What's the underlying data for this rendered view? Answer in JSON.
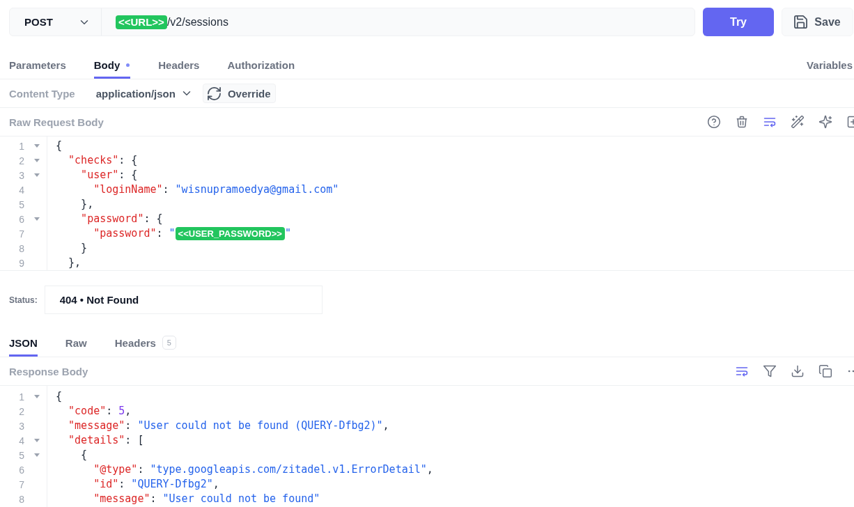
{
  "request": {
    "method": "POST",
    "url_variable": "<<URL>>",
    "url_path": "/v2/sessions",
    "try_button": "Try",
    "save_button": "Save"
  },
  "request_tabs": [
    {
      "label": "Parameters",
      "selected": false,
      "modified": false
    },
    {
      "label": "Body",
      "selected": true,
      "modified": true
    },
    {
      "label": "Headers",
      "selected": false,
      "modified": false
    },
    {
      "label": "Authorization",
      "selected": false,
      "modified": false
    }
  ],
  "variables_button": "Variables",
  "content_type": {
    "label": "Content Type",
    "value": "application/json",
    "override_button": "Override"
  },
  "request_body": {
    "title": "Raw Request Body",
    "toolbar": [
      {
        "kind": "help",
        "active": false
      },
      {
        "kind": "delete",
        "active": false
      },
      {
        "kind": "wrap",
        "active": true
      },
      {
        "kind": "format",
        "active": false
      },
      {
        "kind": "ai",
        "active": false
      },
      {
        "kind": "insert",
        "active": false
      }
    ],
    "lines": [
      {
        "number": "1",
        "foldable": true,
        "tokens": [
          {
            "kind": "punct",
            "text": "{"
          }
        ],
        "children": [
          {
            "number": "2",
            "foldable": true,
            "tokens": [
              {
                "kind": "key",
                "text": "\"checks\""
              },
              {
                "kind": "punct",
                "text": ": {"
              }
            ],
            "children": [
              {
                "number": "3",
                "foldable": true,
                "tokens": [
                  {
                    "kind": "key",
                    "text": "\"user\""
                  },
                  {
                    "kind": "punct",
                    "text": ": {"
                  }
                ],
                "children": [
                  {
                    "number": "4",
                    "foldable": false,
                    "tokens": [
                      {
                        "kind": "key",
                        "text": "\"loginName\""
                      },
                      {
                        "kind": "punct",
                        "text": ": "
                      },
                      {
                        "kind": "string",
                        "text": "\"wisnupramoedya@gmail.com\""
                      }
                    ]
                  }
                ]
              },
              {
                "number": "5",
                "foldable": false,
                "tokens": [
                  {
                    "kind": "punct",
                    "text": "},"
                  }
                ]
              },
              {
                "number": "6",
                "foldable": true,
                "tokens": [
                  {
                    "kind": "key",
                    "text": "\"password\""
                  },
                  {
                    "kind": "punct",
                    "text": ": {"
                  }
                ],
                "children": [
                  {
                    "number": "7",
                    "foldable": false,
                    "tokens": [
                      {
                        "kind": "key",
                        "text": "\"password\""
                      },
                      {
                        "kind": "punct",
                        "text": ": "
                      },
                      {
                        "kind": "string",
                        "text": "\""
                      },
                      {
                        "kind": "variable",
                        "text": "<<USER_PASSWORD>>"
                      },
                      {
                        "kind": "string",
                        "text": "\""
                      }
                    ]
                  }
                ]
              },
              {
                "number": "8",
                "foldable": false,
                "tokens": [
                  {
                    "kind": "punct",
                    "text": "}"
                  }
                ]
              }
            ]
          },
          {
            "number": "9",
            "foldable": false,
            "tokens": [
              {
                "kind": "punct",
                "text": "},"
              }
            ]
          }
        ]
      }
    ]
  },
  "status": {
    "label": "Status:",
    "value": "404 • Not Found"
  },
  "response_tabs": [
    {
      "label": "JSON",
      "selected": true
    },
    {
      "label": "Raw",
      "selected": false
    },
    {
      "label": "Headers",
      "selected": false,
      "badge": "5"
    }
  ],
  "response_body": {
    "title": "Response Body",
    "toolbar": [
      {
        "kind": "wrap",
        "active": true
      },
      {
        "kind": "filter",
        "active": false
      },
      {
        "kind": "download",
        "active": false
      },
      {
        "kind": "copy",
        "active": false
      },
      {
        "kind": "more",
        "active": false
      }
    ],
    "lines": [
      {
        "number": "1",
        "foldable": true,
        "tokens": [
          {
            "kind": "punct",
            "text": "{"
          }
        ],
        "children": [
          {
            "number": "2",
            "foldable": false,
            "tokens": [
              {
                "kind": "key",
                "text": "\"code\""
              },
              {
                "kind": "punct",
                "text": ": "
              },
              {
                "kind": "number",
                "text": "5"
              },
              {
                "kind": "punct",
                "text": ","
              }
            ]
          },
          {
            "number": "3",
            "foldable": false,
            "tokens": [
              {
                "kind": "key",
                "text": "\"message\""
              },
              {
                "kind": "punct",
                "text": ": "
              },
              {
                "kind": "string",
                "text": "\"User could not be found (QUERY-Dfbg2)\""
              },
              {
                "kind": "punct",
                "text": ","
              }
            ]
          },
          {
            "number": "4",
            "foldable": true,
            "tokens": [
              {
                "kind": "key",
                "text": "\"details\""
              },
              {
                "kind": "punct",
                "text": ": ["
              }
            ],
            "children": [
              {
                "number": "5",
                "foldable": true,
                "tokens": [
                  {
                    "kind": "punct",
                    "text": "{"
                  }
                ],
                "children": [
                  {
                    "number": "6",
                    "foldable": false,
                    "tokens": [
                      {
                        "kind": "key",
                        "text": "\"@type\""
                      },
                      {
                        "kind": "punct",
                        "text": ": "
                      },
                      {
                        "kind": "string",
                        "text": "\"type.googleapis.com/zitadel.v1.ErrorDetail\""
                      },
                      {
                        "kind": "punct",
                        "text": ","
                      }
                    ]
                  },
                  {
                    "number": "7",
                    "foldable": false,
                    "tokens": [
                      {
                        "kind": "key",
                        "text": "\"id\""
                      },
                      {
                        "kind": "punct",
                        "text": ": "
                      },
                      {
                        "kind": "string",
                        "text": "\"QUERY-Dfbg2\""
                      },
                      {
                        "kind": "punct",
                        "text": ","
                      }
                    ]
                  },
                  {
                    "number": "8",
                    "foldable": false,
                    "tokens": [
                      {
                        "kind": "key",
                        "text": "\"message\""
                      },
                      {
                        "kind": "punct",
                        "text": ": "
                      },
                      {
                        "kind": "string",
                        "text": "\"User could not be found\""
                      }
                    ]
                  }
                ]
              }
            ]
          }
        ]
      }
    ]
  }
}
